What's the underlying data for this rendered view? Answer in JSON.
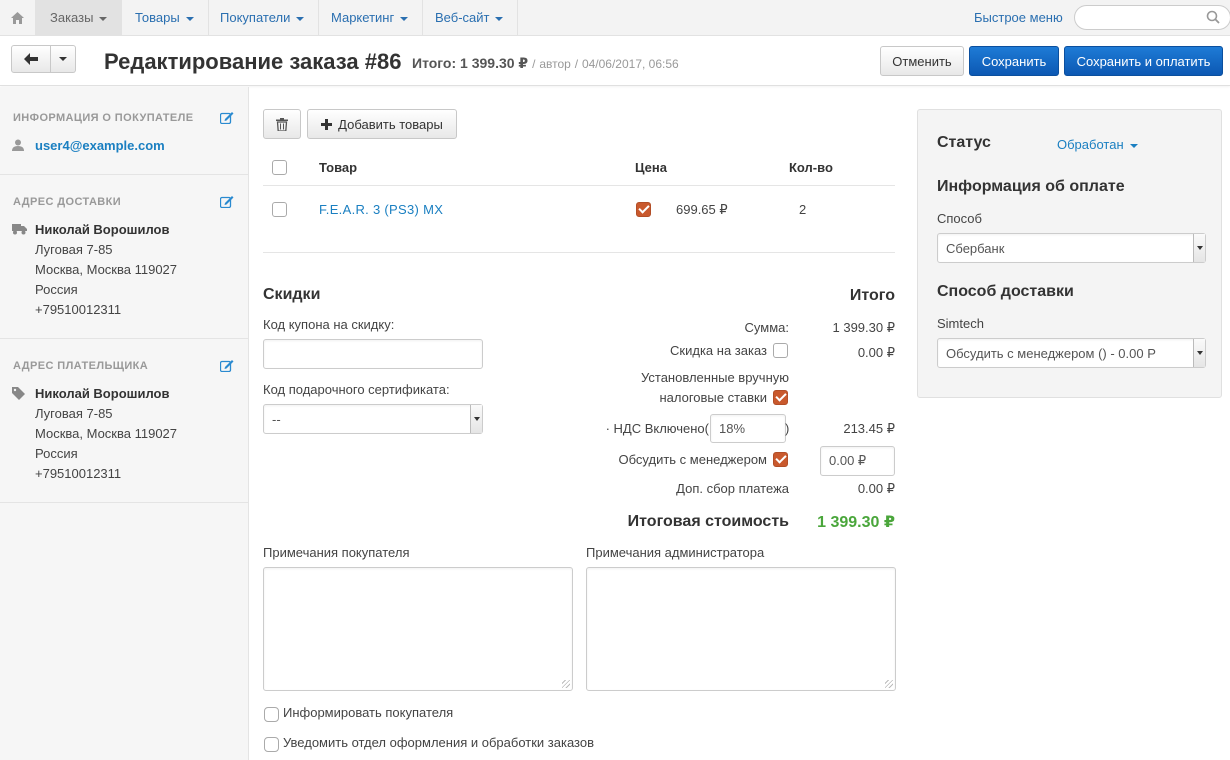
{
  "nav": {
    "home_icon": "home-icon",
    "items": [
      {
        "label": "Заказы"
      },
      {
        "label": "Товары"
      },
      {
        "label": "Покупатели"
      },
      {
        "label": "Маркетинг"
      },
      {
        "label": "Веб-сайт"
      }
    ],
    "quick_menu": "Быстрое меню",
    "search_placeholder": ""
  },
  "header": {
    "title": "Редактирование заказа #86",
    "total_label": "Итого:",
    "total_value": "1 399.30 ₽",
    "sep1": "/",
    "author": "автор",
    "sep2": "/",
    "datetime": "04/06/2017, 06:56",
    "cancel": "Отменить",
    "save": "Сохранить",
    "save_pay": "Сохранить и оплатить"
  },
  "sidebar": {
    "customer": {
      "heading": "Информация о покупателе",
      "email": "user4@example.com"
    },
    "shipping": {
      "heading": "Адрес доставки",
      "name": "Николай Ворошилов",
      "street": "Луговая 7-85",
      "city": "Москва, Москва 119027",
      "country": "Россия",
      "phone": "+79510012311"
    },
    "billing": {
      "heading": "Адрес плательщика",
      "name": "Николай Ворошилов",
      "street": "Луговая 7-85",
      "city": "Москва, Москва 119027",
      "country": "Россия",
      "phone": "+79510012311"
    }
  },
  "products": {
    "add_button": "Добавить товары",
    "columns": {
      "product": "Товар",
      "price": "Цена",
      "qty": "Кол-во"
    },
    "rows": [
      {
        "name": "F.E.A.R. 3 (PS3) MX",
        "price": "699.65 ₽",
        "qty": "2",
        "price_checked": true
      }
    ]
  },
  "discounts": {
    "title": "Скидки",
    "coupon_label": "Код купона на скидку:",
    "coupon_value": "",
    "gift_label": "Код подарочного сертификата:",
    "gift_value": "--"
  },
  "totals": {
    "title": "Итого",
    "subtotal_label": "Сумма:",
    "subtotal_value": "1 399.30 ₽",
    "order_discount_label": "Скидка на заказ",
    "order_discount_value": "0.00 ₽",
    "manual_tax_label_1": "Установленные вручную",
    "manual_tax_label_2": "налоговые ставки",
    "vat_label": "· НДС Включено(",
    "vat_close": ")",
    "vat_rate": "18%",
    "vat_value": "213.45 ₽",
    "discuss_label": "Обсудить с менеджером",
    "discuss_input": "0.00 ₽",
    "payment_fee_label": "Доп. сбор платежа",
    "payment_fee_value": "0.00 ₽",
    "grand_label": "Итоговая стоимость",
    "grand_value": "1 399.30 ₽"
  },
  "notes": {
    "customer_label": "Примечания покупателя",
    "admin_label": "Примечания администратора",
    "notify_customer": "Информировать покупателя",
    "notify_department": "Уведомить отдел оформления и обработки заказов"
  },
  "right": {
    "status_title": "Статус",
    "status_value": "Обработан",
    "payment_title": "Информация об оплате",
    "payment_method_label": "Способ",
    "payment_method_value": "Сбербанк",
    "shipping_title": "Способ доставки",
    "shipping_carrier": "Simtech",
    "shipping_value": "Обсудить с менеджером () - 0.00 Р"
  },
  "colors": {
    "link": "#1a7fc1",
    "primary_button": "#1672cc",
    "checked": "#c9592d",
    "grand_total": "#4aa63b"
  }
}
